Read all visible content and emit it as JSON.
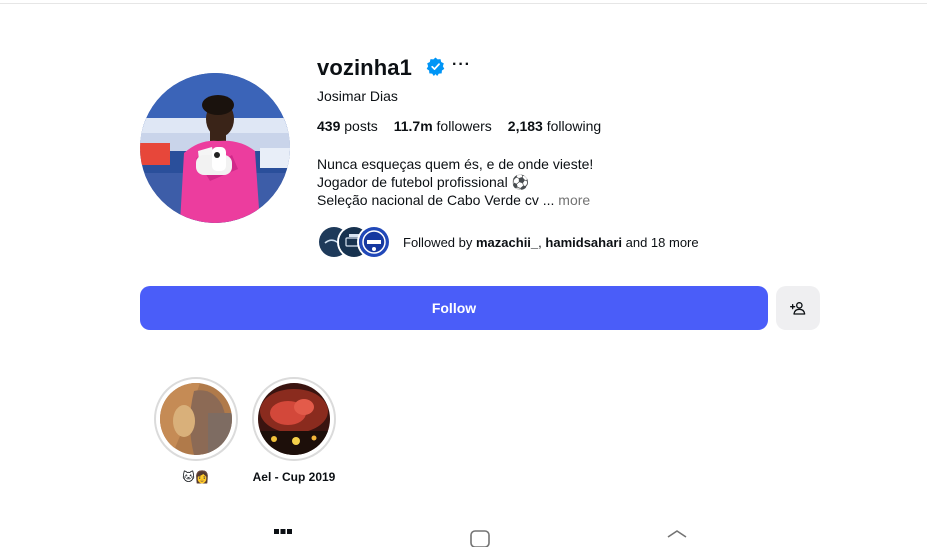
{
  "profile": {
    "username": "vozinha1",
    "full_name": "Josimar Dias",
    "verified": true,
    "stats": {
      "posts": "439",
      "posts_label": "posts",
      "followers": "11.7m",
      "followers_label": "followers",
      "following": "2,183",
      "following_label": "following"
    },
    "bio": [
      "Nunca esqueças quem és, e de onde vieste!",
      "Jogador de futebol profissional ⚽",
      "Seleção nacional de Cabo Verde cv ..."
    ],
    "bio_more": "more",
    "followed_by": {
      "prefix": "Followed by",
      "user1": "mazachii_",
      "sep": ",",
      "user2": "hamidsahari",
      "suffix": "and 18 more"
    }
  },
  "actions": {
    "follow_label": "Follow"
  },
  "highlights": [
    {
      "label": "🐱👩"
    },
    {
      "label": "Ael - Cup 2019"
    }
  ],
  "icons": {
    "verified": "verified-badge-icon",
    "options": "more-options-icon",
    "add_person": "person-add-icon",
    "tab_grid": "grid-icon",
    "tab_reels": "reels-icon",
    "tab_tagged": "tagged-icon"
  },
  "colors": {
    "accent": "#4a5df9",
    "verified": "#0095f6",
    "secondary_text": "#737373"
  }
}
